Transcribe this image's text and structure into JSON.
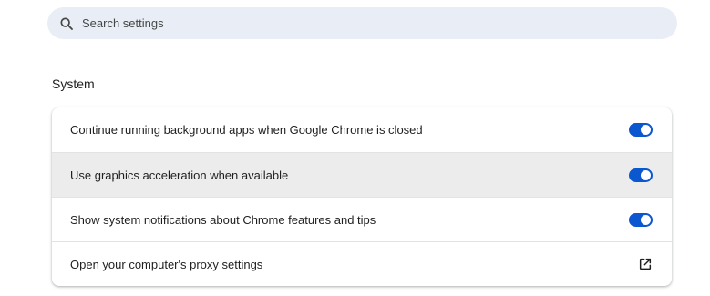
{
  "search": {
    "placeholder": "Search settings",
    "value": ""
  },
  "section": {
    "title": "System"
  },
  "settings": [
    {
      "label": "Continue running background apps when Google Chrome is closed",
      "control": "toggle",
      "enabled": true
    },
    {
      "label": "Use graphics acceleration when available",
      "control": "toggle",
      "enabled": true
    },
    {
      "label": "Show system notifications about Chrome features and tips",
      "control": "toggle",
      "enabled": true
    },
    {
      "label": "Open your computer's proxy settings",
      "control": "external-link",
      "icon": "open-in-new-icon"
    }
  ],
  "colors": {
    "accent": "#0b57d0",
    "search_background": "#e9eef6",
    "hover_row": "#ececec"
  }
}
